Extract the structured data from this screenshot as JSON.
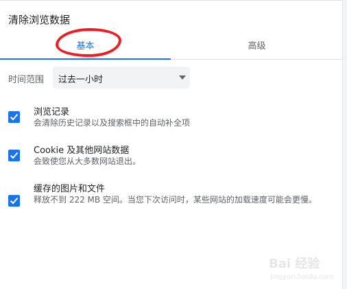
{
  "dialog": {
    "title": "清除浏览数据",
    "tabs": [
      {
        "label": "基本",
        "active": true
      },
      {
        "label": "高级",
        "active": false
      }
    ]
  },
  "time_range": {
    "label": "时间范围",
    "selected": "过去一小时"
  },
  "items": [
    {
      "title": "浏览记录",
      "desc": "会清除历史记录以及搜索框中的自动补全项",
      "checked": true
    },
    {
      "title": "Cookie 及其他网站数据",
      "desc": "会致使您从大多数网站退出。",
      "checked": true
    },
    {
      "title": "缓存的图片和文件",
      "desc": "释放不到 222 MB 空间。当您下次访问时，某些网站的加载速度可能会更慢。",
      "checked": true
    }
  ],
  "watermark": {
    "main": "Bai 经验",
    "sub": "jingyan.baidu.com"
  },
  "colors": {
    "accent": "#1a73e8",
    "annotation": "#ee1c25"
  }
}
